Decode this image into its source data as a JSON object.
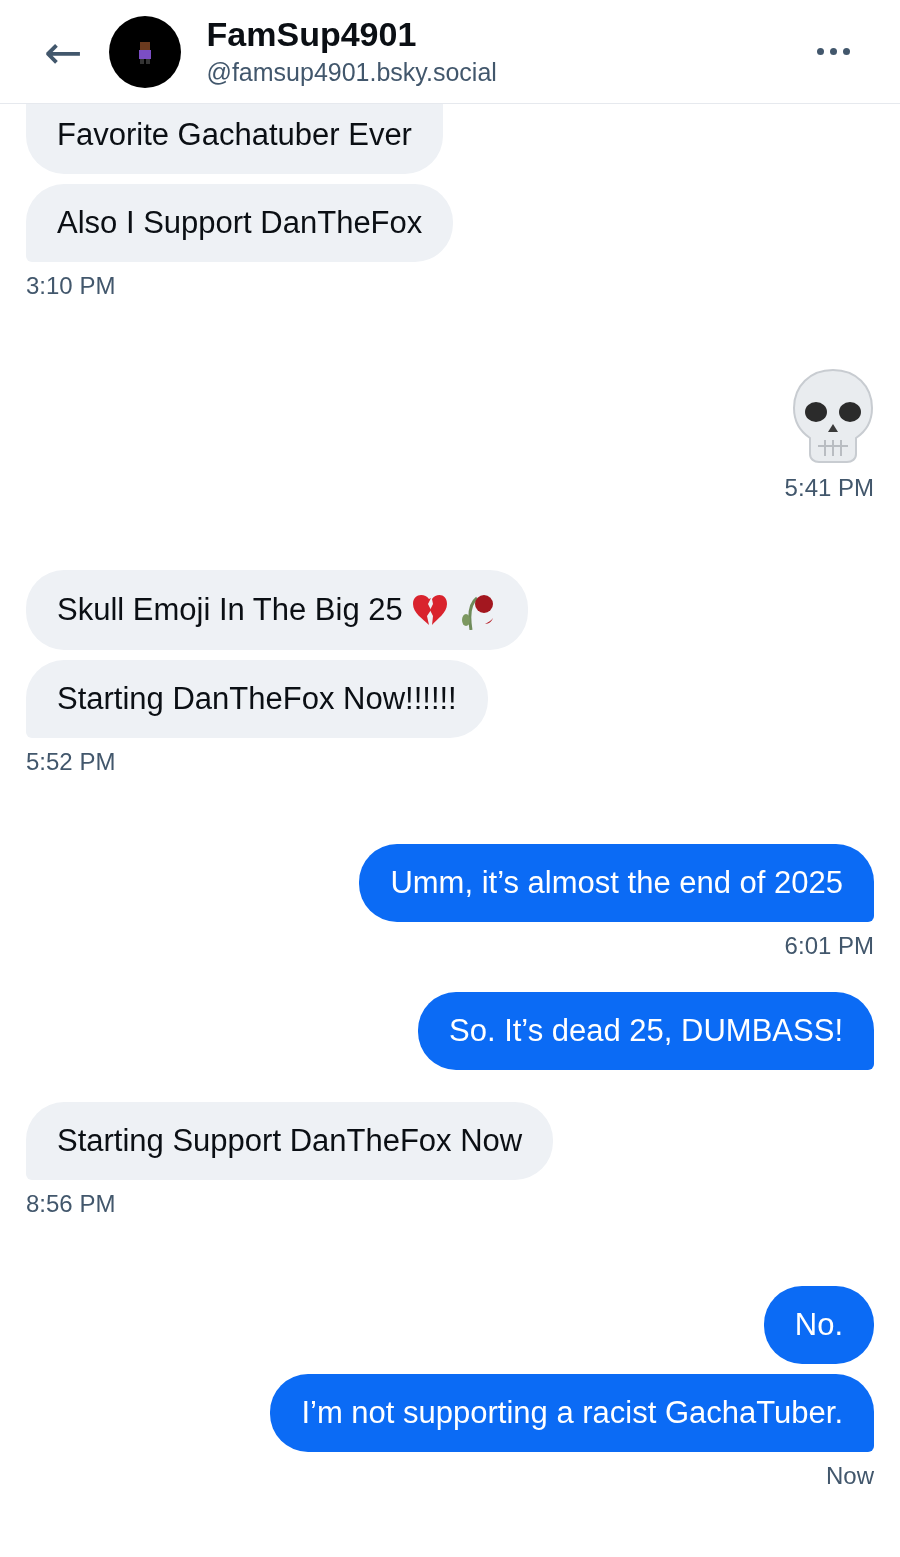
{
  "header": {
    "back": "←",
    "name": "FamSup4901",
    "handle": "@famsup4901.bsky.social"
  },
  "groups": [
    {
      "mine": false,
      "time": "3:10 PM",
      "messages": [
        {
          "kind": "text",
          "text": "Favorite Gachatuber Ever"
        },
        {
          "kind": "text",
          "text": "Also I Support DanTheFox"
        }
      ]
    },
    {
      "mine": true,
      "time": "5:41 PM",
      "messages": [
        {
          "kind": "skull"
        }
      ]
    },
    {
      "mine": false,
      "time": "5:52 PM",
      "messages": [
        {
          "kind": "text-icons",
          "text": "Skull Emoji In The Big 25"
        },
        {
          "kind": "text",
          "text": "Starting DanTheFox Now!!!!!!"
        }
      ]
    },
    {
      "mine": true,
      "time": "6:01 PM",
      "messages": [
        {
          "kind": "text",
          "text": "Umm, it’s almost the end of 2025"
        }
      ]
    },
    {
      "mine": true,
      "messages": [
        {
          "kind": "text",
          "text": "So. It’s dead 25, DUMBASS!"
        }
      ]
    },
    {
      "mine": false,
      "time": "8:56 PM",
      "messages": [
        {
          "kind": "text",
          "text": "Starting Support DanTheFox Now"
        }
      ]
    },
    {
      "mine": true,
      "time": "Now",
      "messages": [
        {
          "kind": "text",
          "text": "No."
        },
        {
          "kind": "text",
          "text": "I’m not supporting a racist GachaTuber."
        }
      ]
    }
  ]
}
